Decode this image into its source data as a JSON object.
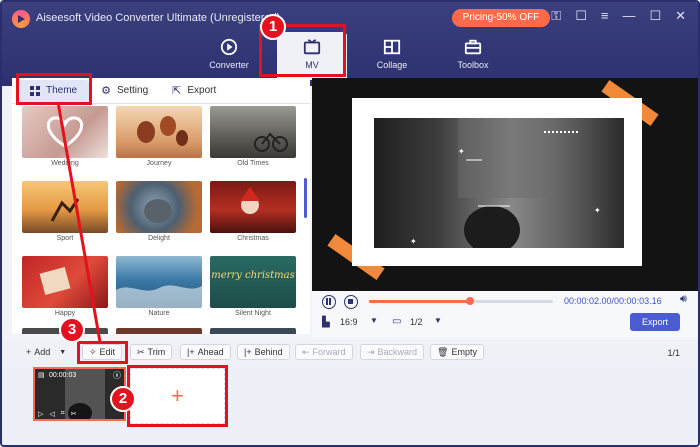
{
  "app": {
    "title": "Aiseesoft Video Converter Ultimate (Unregistered)",
    "pricing": "Pricing-50% OFF"
  },
  "nav": {
    "items": [
      {
        "label": "Converter",
        "icon": "converter-icon"
      },
      {
        "label": "MV",
        "icon": "mv-icon"
      },
      {
        "label": "Collage",
        "icon": "collage-icon"
      },
      {
        "label": "Toolbox",
        "icon": "toolbox-icon"
      }
    ],
    "active": "MV"
  },
  "subtabs": {
    "theme": "Theme",
    "setting": "Setting",
    "export": "Export"
  },
  "themes": [
    {
      "label": "Wedding"
    },
    {
      "label": "Journey"
    },
    {
      "label": "Old Times"
    },
    {
      "label": "Sport"
    },
    {
      "label": "Delight"
    },
    {
      "label": "Christmas"
    },
    {
      "label": "Happy"
    },
    {
      "label": "Nature"
    },
    {
      "label": "Silent Night"
    }
  ],
  "christmas_thumb_text": "merry christmas",
  "player": {
    "time": "00:00:02.00/00:00:03.16",
    "progress": 0.55,
    "aspect": "16:9",
    "page": "1/2",
    "export": "Export"
  },
  "toolbar": {
    "add": "Add",
    "edit": "Edit",
    "trim": "Trim",
    "ahead": "Ahead",
    "behind": "Behind",
    "forward": "Forward",
    "backward": "Backward",
    "empty": "Empty",
    "count": "1/1"
  },
  "clip": {
    "time": "00:00:03"
  },
  "callouts": [
    "1",
    "2",
    "3"
  ],
  "colors": {
    "accent": "#ff6a4d",
    "brand": "#2d3170",
    "highlight": "#e3121e",
    "button": "#4b5bd1"
  }
}
